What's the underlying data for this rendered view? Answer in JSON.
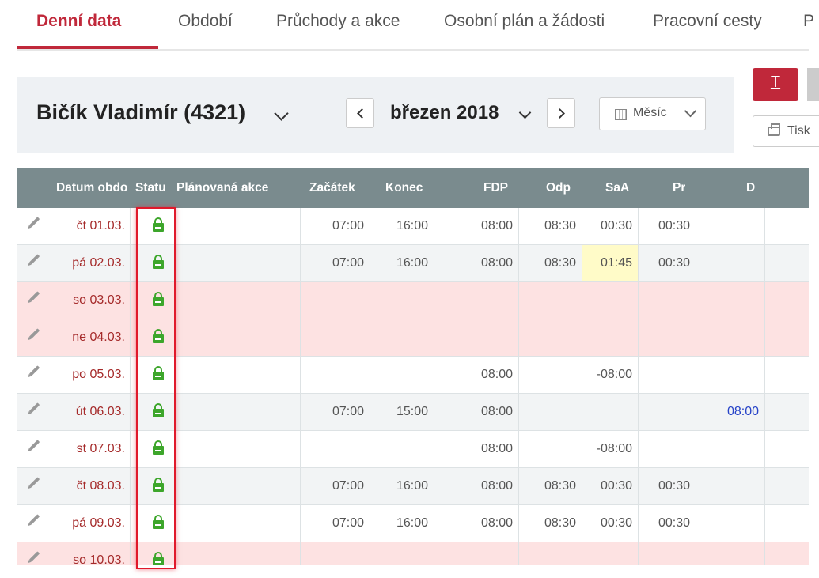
{
  "tabs": [
    {
      "label": "Denní data",
      "active": true
    },
    {
      "label": "Období"
    },
    {
      "label": "Průchody a akce"
    },
    {
      "label": "Osobní plán a žádosti"
    },
    {
      "label": "Pracovní cesty"
    },
    {
      "label": "P"
    }
  ],
  "toolbar": {
    "employee": "Bičík Vladimír (4321)",
    "month": "březen 2018",
    "view": "Měsíc",
    "print_label": "Tisk",
    "red_button_glyph": "T"
  },
  "table": {
    "headers": [
      "Datum obdo",
      "Statu",
      "Plánovaná akce",
      "Začátek",
      "Konec",
      "FDP",
      "Odp",
      "SaA",
      "Pr",
      "D"
    ],
    "rows": [
      {
        "date": "čt 01.03.",
        "start": "07:00",
        "end": "16:00",
        "fdp": "08:00",
        "odp": "08:30",
        "saa": "00:30",
        "pr": "00:30",
        "d": ""
      },
      {
        "date": "pá 02.03.",
        "start": "07:00",
        "end": "16:00",
        "fdp": "08:00",
        "odp": "08:30",
        "saa": "01:45",
        "pr": "00:30",
        "d": ""
      },
      {
        "date": "so 03.03.",
        "start": "",
        "end": "",
        "fdp": "",
        "odp": "",
        "saa": "",
        "pr": "",
        "d": ""
      },
      {
        "date": "ne 04.03.",
        "start": "",
        "end": "",
        "fdp": "",
        "odp": "",
        "saa": "",
        "pr": "",
        "d": ""
      },
      {
        "date": "po 05.03.",
        "start": "",
        "end": "",
        "fdp": "08:00",
        "odp": "",
        "saa": "-08:00",
        "pr": "",
        "d": ""
      },
      {
        "date": "út 06.03.",
        "start": "07:00",
        "end": "15:00",
        "fdp": "08:00",
        "odp": "",
        "saa": "",
        "pr": "",
        "d": "08:00"
      },
      {
        "date": "st 07.03.",
        "start": "",
        "end": "",
        "fdp": "08:00",
        "odp": "",
        "saa": "-08:00",
        "pr": "",
        "d": ""
      },
      {
        "date": "čt 08.03.",
        "start": "07:00",
        "end": "16:00",
        "fdp": "08:00",
        "odp": "08:30",
        "saa": "00:30",
        "pr": "00:30",
        "d": ""
      },
      {
        "date": "pá 09.03.",
        "start": "07:00",
        "end": "16:00",
        "fdp": "08:00",
        "odp": "08:30",
        "saa": "00:30",
        "pr": "00:30",
        "d": ""
      },
      {
        "date": "so 10.03.",
        "start": "",
        "end": "",
        "fdp": "",
        "odp": "",
        "saa": "",
        "pr": "",
        "d": ""
      }
    ]
  },
  "colors": {
    "accent": "#c0283a",
    "header_bg": "#7a8b8e",
    "weekend_row": "#fde2e2",
    "lock": "#3da62b",
    "highlight_box": "#e0192b"
  }
}
